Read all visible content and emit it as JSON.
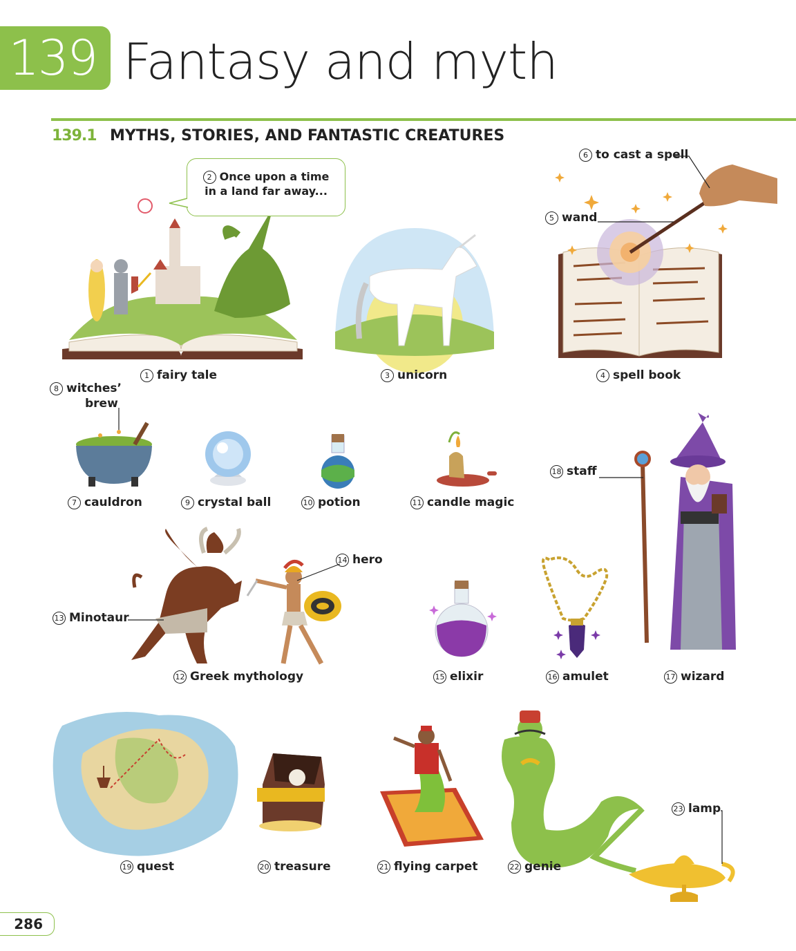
{
  "header": {
    "chapter_number": "139",
    "title": "Fantasy and myth",
    "accent_color": "#8dc04b"
  },
  "section": {
    "number": "139.1",
    "title": "MYTHS, STORIES, AND FANTASTIC CREATURES"
  },
  "speech_bubble": {
    "number": "2",
    "line1": "Once upon a time",
    "line2": "in a land far away..."
  },
  "items": [
    {
      "n": "1",
      "label": "fairy tale"
    },
    {
      "n": "3",
      "label": "unicorn"
    },
    {
      "n": "4",
      "label": "spell book"
    },
    {
      "n": "5",
      "label": "wand"
    },
    {
      "n": "6",
      "label": "to cast a spell"
    },
    {
      "n": "7",
      "label": "cauldron"
    },
    {
      "n": "8",
      "label": "witches’",
      "label2": "brew"
    },
    {
      "n": "9",
      "label": "crystal ball"
    },
    {
      "n": "10",
      "label": "potion"
    },
    {
      "n": "11",
      "label": "candle magic"
    },
    {
      "n": "12",
      "label": "Greek mythology"
    },
    {
      "n": "13",
      "label": "Minotaur"
    },
    {
      "n": "14",
      "label": "hero"
    },
    {
      "n": "15",
      "label": "elixir"
    },
    {
      "n": "16",
      "label": "amulet"
    },
    {
      "n": "17",
      "label": "wizard"
    },
    {
      "n": "18",
      "label": "staff"
    },
    {
      "n": "19",
      "label": "quest"
    },
    {
      "n": "20",
      "label": "treasure"
    },
    {
      "n": "21",
      "label": "flying carpet"
    },
    {
      "n": "22",
      "label": "genie"
    },
    {
      "n": "23",
      "label": "lamp"
    }
  ],
  "page_number": "286"
}
